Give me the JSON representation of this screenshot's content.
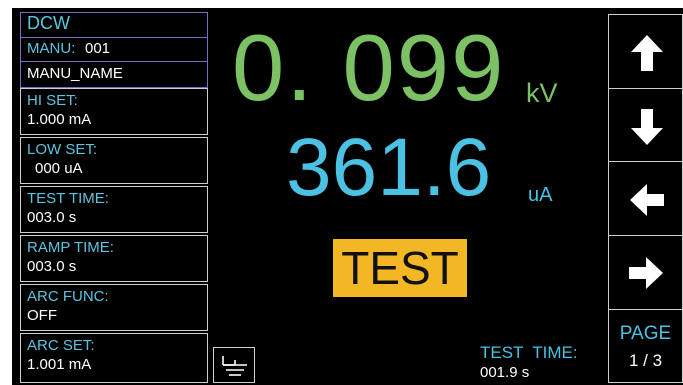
{
  "mode": "DCW",
  "manu": {
    "label": "MANU:",
    "number": "001",
    "name": "MANU_NAME"
  },
  "params": [
    {
      "label": "HI SET:",
      "value": "1.000 mA"
    },
    {
      "label": "LOW SET:",
      "value": "000 uA"
    },
    {
      "label": "TEST TIME:",
      "value": "003.0 s"
    },
    {
      "label": "RAMP TIME:",
      "value": "003.0 s"
    },
    {
      "label": "ARC FUNC:",
      "value": "OFF"
    },
    {
      "label": "ARC SET:",
      "value": "1.001 mA"
    }
  ],
  "readings": {
    "voltage": "0. 099",
    "voltage_unit": "kV",
    "current": "361.6",
    "current_unit": "uA"
  },
  "status": "TEST",
  "elapsed": {
    "label": "TEST  TIME:",
    "value": "001.9 s"
  },
  "nav": {
    "up_icon": "arrow-up-icon",
    "down_icon": "arrow-down-icon",
    "left_icon": "arrow-left-icon",
    "right_icon": "arrow-right-icon",
    "page_label": "PAGE",
    "page_value": "1 / 3"
  },
  "ground_icon": "ground-icon",
  "colors": {
    "voltage": "#7cc264",
    "current": "#4bc1e3",
    "label": "#5dc4e0",
    "status_bg": "#f3b725"
  }
}
